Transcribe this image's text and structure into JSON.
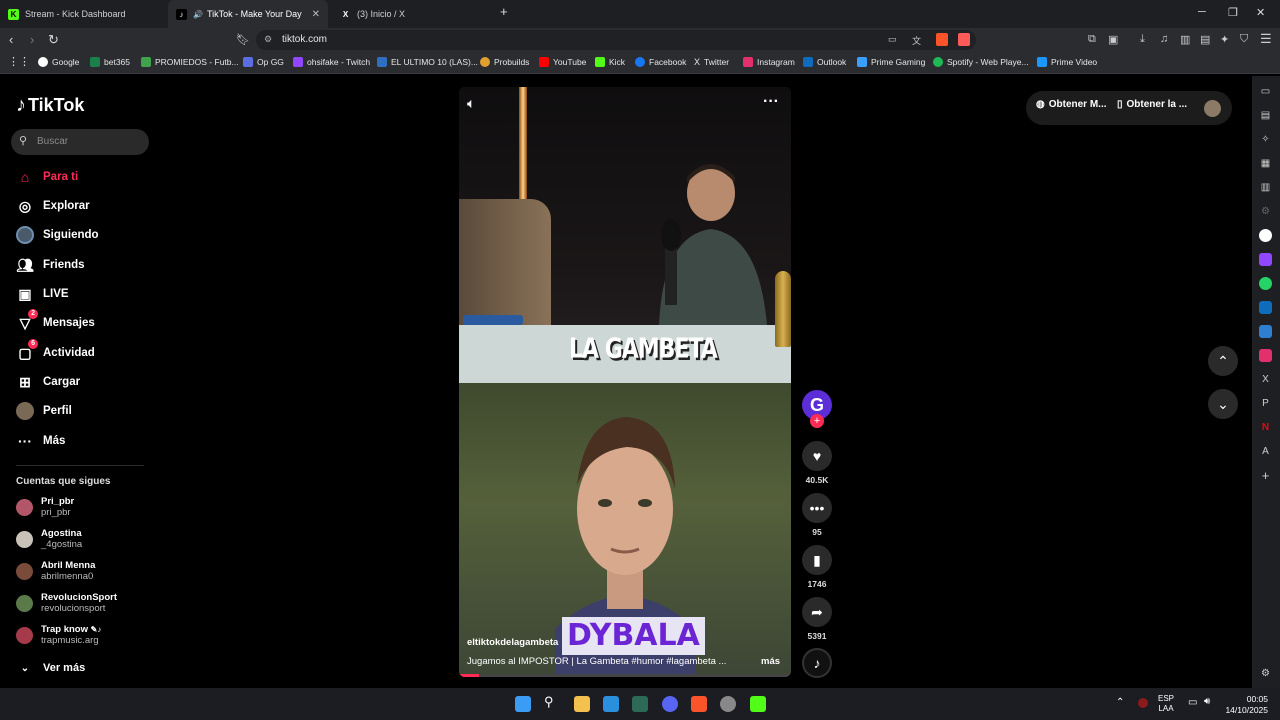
{
  "browser": {
    "tabs": [
      {
        "title": "Stream - Kick Dashboard",
        "active": false
      },
      {
        "title": "TikTok - Make Your Day",
        "active": true
      },
      {
        "title": "(3) Inicio / X",
        "active": false
      }
    ],
    "url": "tiktok.com",
    "bookmarks": [
      {
        "label": "Google",
        "color": "#ffffff"
      },
      {
        "label": "bet365",
        "color": "#1a7f4b"
      },
      {
        "label": "PROMIEDOS - Futb...",
        "color": "#3fa34d"
      },
      {
        "label": "Op GG",
        "color": "#5b6ee1"
      },
      {
        "label": "ohsifake - Twitch",
        "color": "#9146ff"
      },
      {
        "label": "EL ULTIMO 10 (LAS)...",
        "color": "#2f6fbf"
      },
      {
        "label": "Probuilds",
        "color": "#e0a030"
      },
      {
        "label": "YouTube",
        "color": "#ff0000"
      },
      {
        "label": "Kick",
        "color": "#53fc18"
      },
      {
        "label": "Facebook",
        "color": "#1877f2"
      },
      {
        "label": "Twitter",
        "color": "#ffffff"
      },
      {
        "label": "Instagram",
        "color": "#e1306c"
      },
      {
        "label": "Outlook",
        "color": "#0f6cbd"
      },
      {
        "label": "Prime Gaming",
        "color": "#3aa0ff"
      },
      {
        "label": "Spotify - Web Playe...",
        "color": "#1db954"
      },
      {
        "label": "Prime Video",
        "color": "#1a98ff"
      }
    ]
  },
  "tiktok": {
    "logo": "TikTok",
    "search_placeholder": "Buscar",
    "nav": [
      {
        "label": "Para ti",
        "icon": "home-icon",
        "active": true
      },
      {
        "label": "Explorar",
        "icon": "compass-icon"
      },
      {
        "label": "Siguiendo",
        "icon": "following-avatar-icon"
      },
      {
        "label": "Friends",
        "icon": "friends-icon"
      },
      {
        "label": "LIVE",
        "icon": "live-icon"
      },
      {
        "label": "Mensajes",
        "icon": "messages-icon",
        "badge": "2"
      },
      {
        "label": "Actividad",
        "icon": "activity-icon",
        "badge": "6"
      },
      {
        "label": "Cargar",
        "icon": "upload-icon"
      },
      {
        "label": "Perfil",
        "icon": "profile-icon"
      },
      {
        "label": "Más",
        "icon": "more-icon"
      }
    ],
    "following_title": "Cuentas que sigues",
    "following": [
      {
        "name": "Pri_pbr",
        "handle": "pri_pbr"
      },
      {
        "name": "Agostina",
        "handle": "_4gostina"
      },
      {
        "name": "Abril Menna",
        "handle": "abrilmenna0"
      },
      {
        "name": "RevolucionSport",
        "handle": "revolucionsport"
      },
      {
        "name": "Trap know",
        "handle": "trapmusic.arg"
      }
    ],
    "see_more": "Ver más",
    "top_buttons": [
      "Obtener M...",
      "Obtener la ..."
    ],
    "video": {
      "overlay_brand": "LA GAMBETA",
      "overlay_title": "DYBALA",
      "user": "eltiktokdelagambeta",
      "description": "Jugamos al IMPOSTOR | La Gambeta #humor #lagambeta ...",
      "more": "más",
      "progress": 0.06
    },
    "actions": {
      "creator_initial": "G",
      "likes": "40.5K",
      "comments": "95",
      "saves": "1746",
      "shares": "5391"
    }
  },
  "taskbar": {
    "lang_top": "ESP",
    "lang_bottom": "LAA",
    "time": "00:05",
    "date": "14/10/2025"
  }
}
